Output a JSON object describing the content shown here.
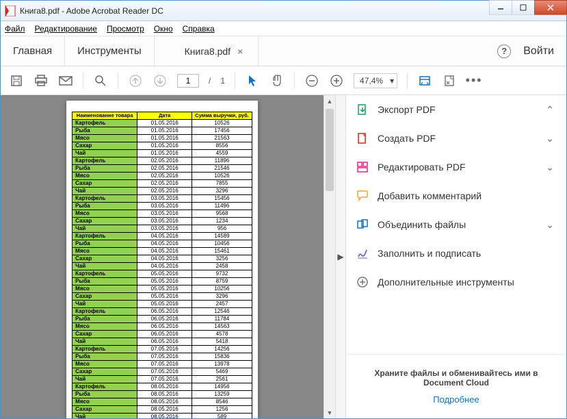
{
  "window": {
    "title": "Книга8.pdf - Adobe Acrobat Reader DC"
  },
  "menubar": {
    "file": "Файл",
    "edit": "Редактирование",
    "view": "Просмотр",
    "window": "Окно",
    "help": "Справка"
  },
  "tabs": {
    "home": "Главная",
    "tools": "Инструменты",
    "doc": "Книга8.pdf",
    "signin": "Войти"
  },
  "toolbar": {
    "page_current": "1",
    "page_sep": "/",
    "page_total": "1",
    "zoom": "47,4%"
  },
  "table": {
    "headers": [
      "Наименование товара",
      "Дата",
      "Сумма выручки, руб."
    ],
    "rows": [
      [
        "Картофель",
        "01.05.2016",
        "10526"
      ],
      [
        "Рыба",
        "01.05.2016",
        "17456"
      ],
      [
        "Мясо",
        "01.05.2016",
        "21563"
      ],
      [
        "Сахар",
        "01.05.2016",
        "8556"
      ],
      [
        "Чай",
        "01.05.2016",
        "4559"
      ],
      [
        "Картофель",
        "02.05.2016",
        "11896"
      ],
      [
        "Рыба",
        "02.05.2016",
        "21546"
      ],
      [
        "Мясо",
        "02.05.2016",
        "10526"
      ],
      [
        "Сахар",
        "02.05.2016",
        "7855"
      ],
      [
        "Чай",
        "02.05.2016",
        "3296"
      ],
      [
        "Картофель",
        "03.05.2016",
        "15456"
      ],
      [
        "Рыба",
        "03.05.2016",
        "11496"
      ],
      [
        "Мясо",
        "03.05.2016",
        "9568"
      ],
      [
        "Сахар",
        "03.05.2016",
        "1234"
      ],
      [
        "Чай",
        "03.05.2016",
        "956"
      ],
      [
        "Картофель",
        "04.05.2016",
        "14589"
      ],
      [
        "Рыба",
        "04.05.2016",
        "10456"
      ],
      [
        "Мясо",
        "04.05.2016",
        "15461"
      ],
      [
        "Сахар",
        "04.05.2016",
        "3256"
      ],
      [
        "Чай",
        "04.05.2016",
        "2458"
      ],
      [
        "Картофель",
        "05.05.2016",
        "9732"
      ],
      [
        "Рыба",
        "05.05.2016",
        "8759"
      ],
      [
        "Мясо",
        "05.05.2016",
        "10256"
      ],
      [
        "Сахар",
        "05.05.2016",
        "3296"
      ],
      [
        "Чай",
        "05.05.2016",
        "2457"
      ],
      [
        "Картофель",
        "06.05.2016",
        "12546"
      ],
      [
        "Рыба",
        "06.05.2016",
        "11784"
      ],
      [
        "Мясо",
        "06.05.2016",
        "14563"
      ],
      [
        "Сахар",
        "06.05.2016",
        "4578"
      ],
      [
        "Чай",
        "06.05.2016",
        "5418"
      ],
      [
        "Картофель",
        "07.05.2016",
        "14256"
      ],
      [
        "Рыба",
        "07.05.2016",
        "15836"
      ],
      [
        "Мясо",
        "07.05.2016",
        "13978"
      ],
      [
        "Сахар",
        "07.05.2016",
        "5469"
      ],
      [
        "Чай",
        "07.05.2016",
        "2561"
      ],
      [
        "Картофель",
        "08.05.2016",
        "14956"
      ],
      [
        "Рыба",
        "08.05.2016",
        "13259"
      ],
      [
        "Мясо",
        "08.05.2016",
        "8546"
      ],
      [
        "Сахар",
        "08.05.2016",
        "1256"
      ],
      [
        "Чай",
        "08.05.2016",
        "589"
      ]
    ]
  },
  "rpanel": {
    "export_pdf": "Экспорт PDF",
    "create_pdf": "Создать PDF",
    "edit_pdf": "Редактировать PDF",
    "comment": "Добавить комментарий",
    "combine": "Объединить файлы",
    "fill_sign": "Заполнить и подписать",
    "more_tools": "Дополнительные инструменты",
    "promo_line1": "Храните файлы и обменивайтесь ими в",
    "promo_line2": "Document Cloud",
    "promo_link": "Подробнее"
  }
}
